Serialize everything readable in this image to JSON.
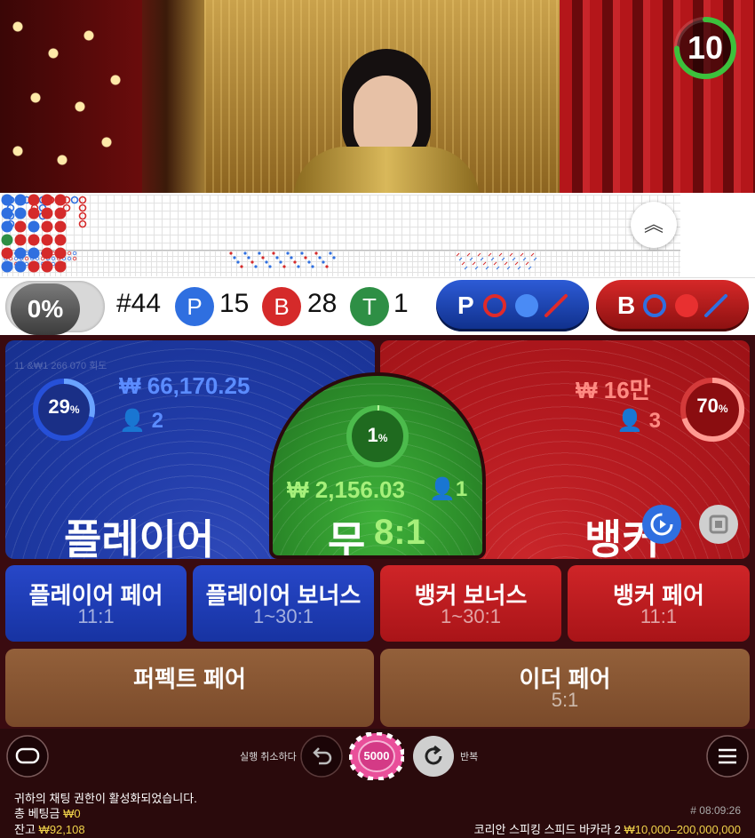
{
  "timer": {
    "seconds": "10"
  },
  "roadmap": {
    "collapse_icon": "chevron-up-double-icon",
    "big_road_symbols": [
      "P",
      "P",
      "P",
      "P",
      "B",
      "P",
      "B",
      "B",
      "P",
      "P",
      "P",
      "B",
      "P",
      "B",
      "B",
      "P",
      "B",
      "B",
      "B",
      "B"
    ]
  },
  "stats": {
    "toggle_label": "0%",
    "round": "#44",
    "player_letter": "P",
    "player_count": "15",
    "banker_letter": "B",
    "banker_count": "28",
    "tie_letter": "T",
    "tie_count": "1",
    "player_ask_label": "P",
    "banker_ask_label": "B"
  },
  "bets": {
    "player": {
      "percent": "29",
      "percent_sign": "%",
      "amount": "₩ 66,170.25",
      "players": "2",
      "label": "플레이어",
      "percent_value": 0.29
    },
    "banker": {
      "percent": "70",
      "percent_sign": "%",
      "amount": "₩ 16만",
      "players": "3",
      "label": "뱅커",
      "percent_value": 0.7
    },
    "tie": {
      "percent": "1",
      "percent_sign": "%",
      "amount": "₩ 2,156.03",
      "players": "1",
      "label": "무",
      "payout": "8:1",
      "percent_value": 0.01
    },
    "faint_limit": "11 &₩1 266 070 회도"
  },
  "side_bets": [
    {
      "name": "플레이어 페어",
      "payout": "11:1"
    },
    {
      "name": "플레이어 보너스",
      "payout": "1~30:1"
    },
    {
      "name": "뱅커 보너스",
      "payout": "1~30:1"
    },
    {
      "name": "뱅커 페어",
      "payout": "11:1"
    },
    {
      "name": "퍼펙트 페어",
      "payout": ""
    },
    {
      "name": "이더 페어",
      "payout": "5:1"
    }
  ],
  "controls": {
    "undo_label": "실행 취소하다",
    "repeat_label": "반복",
    "chip_value": "5000"
  },
  "footer": {
    "chat_notice": "귀하의 채팅 권한이 활성화되었습니다.",
    "total_bet_label": "총 베팅금",
    "total_bet_value": "₩0",
    "balance_label": "잔고",
    "balance_value": "₩92,108",
    "round_id": "# 08:09:26",
    "table_name": "코리안 스피킹 스피드 바카라 2",
    "table_limits": "₩10,000–200,000,000"
  },
  "colors": {
    "player": "#1f3aa5",
    "banker": "#b3191f",
    "tie": "#2c8d2a",
    "accent_yellow": "#f1d34a",
    "timer_green": "#3cc13c"
  }
}
